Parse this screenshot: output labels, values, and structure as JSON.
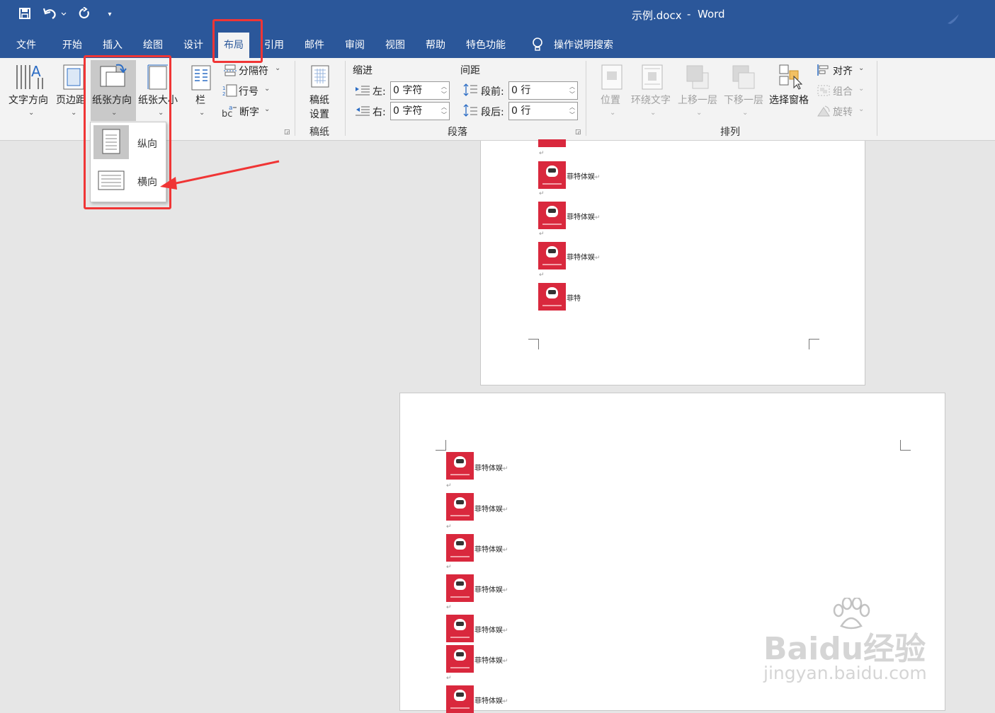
{
  "window": {
    "title": "示例.docx",
    "separator": "-",
    "app": "Word"
  },
  "tabs": [
    "文件",
    "开始",
    "插入",
    "绘图",
    "设计",
    "布局",
    "引用",
    "邮件",
    "审阅",
    "视图",
    "帮助",
    "特色功能"
  ],
  "active_tab": "布局",
  "tell_me": "操作说明搜索",
  "ribbon": {
    "page_setup": {
      "text_direction": "文字方向",
      "margins": "页边距",
      "orientation": "纸张方向",
      "size": "纸张大小",
      "columns": "栏",
      "breaks": "分隔符",
      "line_numbers": "行号",
      "hyphenation": "断字"
    },
    "manuscript": {
      "button_line1": "稿纸",
      "button_line2": "设置",
      "group": "稿纸"
    },
    "paragraph": {
      "indent": "缩进",
      "spacing": "间距",
      "left_label": "左:",
      "left_value": "0 字符",
      "right_label": "右:",
      "right_value": "0 字符",
      "before_label": "段前:",
      "before_value": "0 行",
      "after_label": "段后:",
      "after_value": "0 行",
      "group": "段落"
    },
    "arrange": {
      "position": "位置",
      "wrap_text": "环绕文字",
      "bring_forward": "上移一层",
      "send_backward": "下移一层",
      "selection_pane": "选择窗格",
      "align": "对齐",
      "group_btn": "组合",
      "rotate": "旋转",
      "group": "排列"
    }
  },
  "orientation_menu": {
    "portrait": "纵向",
    "landscape": "横向"
  },
  "document": {
    "item_text": "菲特体娱",
    "last_item_text": "菲特",
    "paragraph_mark": "↵"
  },
  "watermark": {
    "line1": "Baidu经验",
    "line2": "jingyan.baidu.com"
  },
  "colors": {
    "title_bar": "#2b579a",
    "highlight": "#f03535",
    "logo_red": "#d9283d"
  }
}
